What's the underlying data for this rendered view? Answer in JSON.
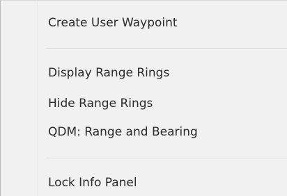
{
  "context_menu": {
    "items": [
      {
        "label": "Create User Waypoint"
      },
      {
        "label": "Display Range Rings"
      },
      {
        "label": "Hide Range Rings"
      },
      {
        "label": "QDM: Range and Bearing"
      },
      {
        "label": "Lock Info Panel"
      }
    ]
  }
}
